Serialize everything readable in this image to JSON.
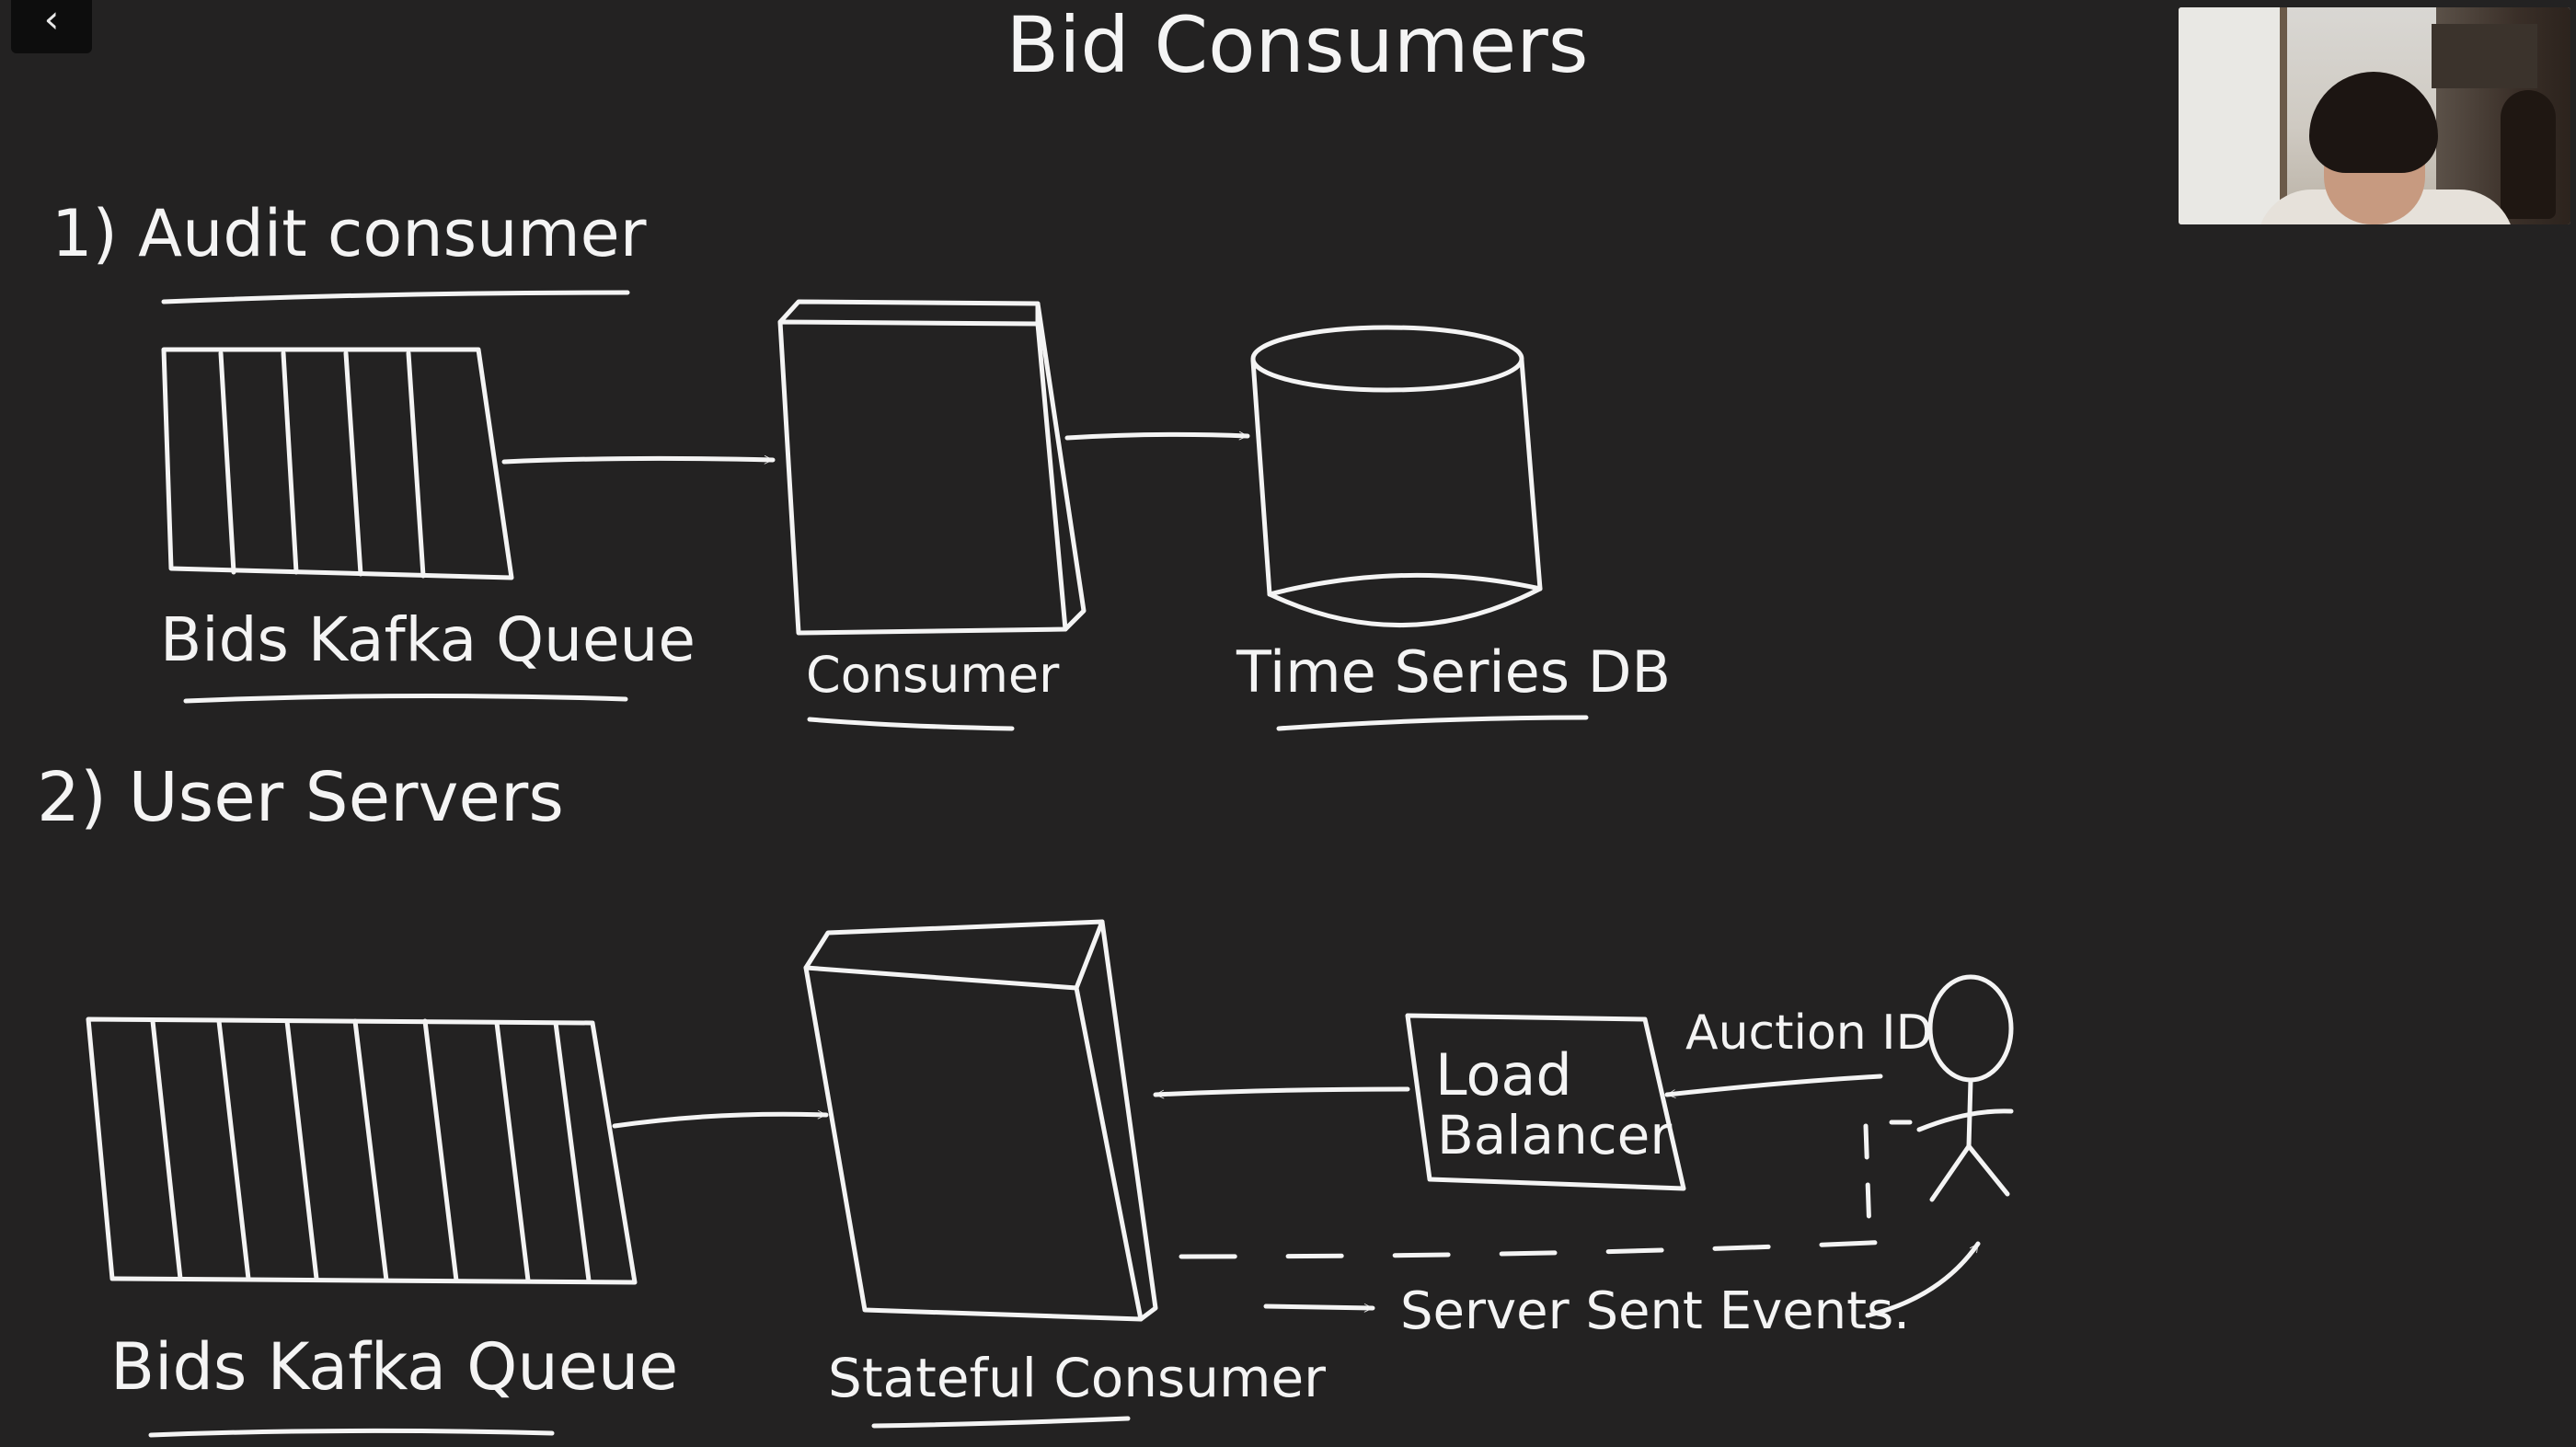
{
  "title": "Bid Consumers",
  "section1": {
    "heading": "1) Audit consumer",
    "queue_label": "Bids Kafka Queue",
    "consumer_label": "Consumer",
    "db_label": "Time Series DB"
  },
  "section2": {
    "heading": "2) User Servers",
    "queue_label": "Bids Kafka Queue",
    "consumer_label": "Stateful Consumer",
    "lb_label_line1": "Load",
    "lb_label_line2": "Balancer",
    "auction_label": "Auction ID",
    "sse_label": "Server Sent Events."
  },
  "controls": {
    "back_glyph": "‹"
  },
  "colors": {
    "background": "#232222",
    "ink": "#f4f4f4"
  }
}
